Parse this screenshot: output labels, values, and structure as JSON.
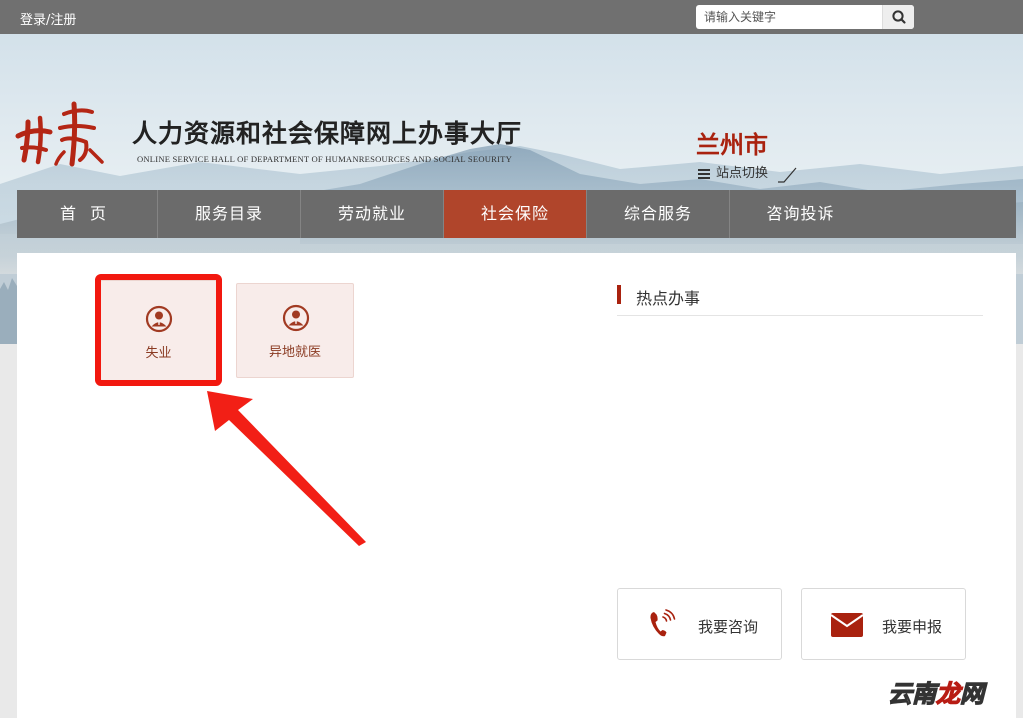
{
  "topbar": {
    "login_label": "登录/注册",
    "search_placeholder": "请输入关键字",
    "search_icon": "search-icon"
  },
  "header": {
    "logo_text": "甘肃",
    "title": "人力资源和社会保障网上办事大厅",
    "subtitle": "ONLINE SERVICE HALL OF DEPARTMENT OF HUMANRESOURCES AND SOCIAL SEOURITY",
    "city": "兰州市",
    "switch_label": "站点切换",
    "switch_icon": "menu-icon"
  },
  "nav": {
    "items": [
      {
        "label": "首页",
        "active": false
      },
      {
        "label": "服务目录",
        "active": false
      },
      {
        "label": "劳动就业",
        "active": false
      },
      {
        "label": "社会保险",
        "active": true
      },
      {
        "label": "综合服务",
        "active": false
      },
      {
        "label": "咨询投诉",
        "active": false
      }
    ]
  },
  "services": [
    {
      "label": "失业",
      "icon": "person-icon",
      "highlighted": true
    },
    {
      "label": "异地就医",
      "icon": "person-icon",
      "highlighted": false
    }
  ],
  "hot": {
    "title": "热点办事"
  },
  "actions": [
    {
      "label": "我要咨询",
      "icon": "phone-icon"
    },
    {
      "label": "我要申报",
      "icon": "envelope-icon"
    }
  ],
  "watermark": {
    "part1": "云南",
    "part2": "龙",
    "part3": "网"
  },
  "colors": {
    "accent": "#a9220f",
    "nav_bg": "#6b6b6b",
    "nav_active": "#b0452b",
    "highlight": "#f2180f",
    "card_bg": "#f8ecea"
  }
}
